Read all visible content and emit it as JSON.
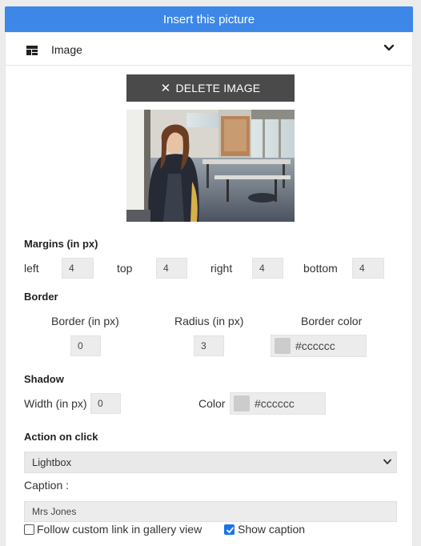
{
  "insert_button": "Insert this picture",
  "panel": {
    "title": "Image",
    "icon": "grid-icon",
    "chevron": "chevron-down-icon"
  },
  "delete_button": "DELETE IMAGE",
  "margins": {
    "title": "Margins (in px)",
    "left_label": "left",
    "left_value": "4",
    "top_label": "top",
    "top_value": "4",
    "right_label": "right",
    "right_value": "4",
    "bottom_label": "bottom",
    "bottom_value": "4"
  },
  "border": {
    "title": "Border",
    "width_label": "Border (in px)",
    "width_value": "0",
    "radius_label": "Radius (in px)",
    "radius_value": "3",
    "color_label": "Border color",
    "color_value": "#cccccc"
  },
  "shadow": {
    "title": "Shadow",
    "width_label": "Width (in px)",
    "width_value": "0",
    "color_label": "Color",
    "color_value": "#cccccc"
  },
  "action": {
    "title": "Action on click",
    "selected": "Lightbox"
  },
  "caption": {
    "label": "Caption :",
    "value": "Mrs Jones"
  },
  "options": {
    "follow_link_label": "Follow custom link in gallery view",
    "follow_link_checked": false,
    "show_caption_label": "Show caption",
    "show_caption_checked": true
  },
  "colors": {
    "accent": "#3c87e8",
    "delete_bg": "#4a4a4a",
    "swatch": "#cccccc",
    "checkbox": "#1a73e8"
  }
}
